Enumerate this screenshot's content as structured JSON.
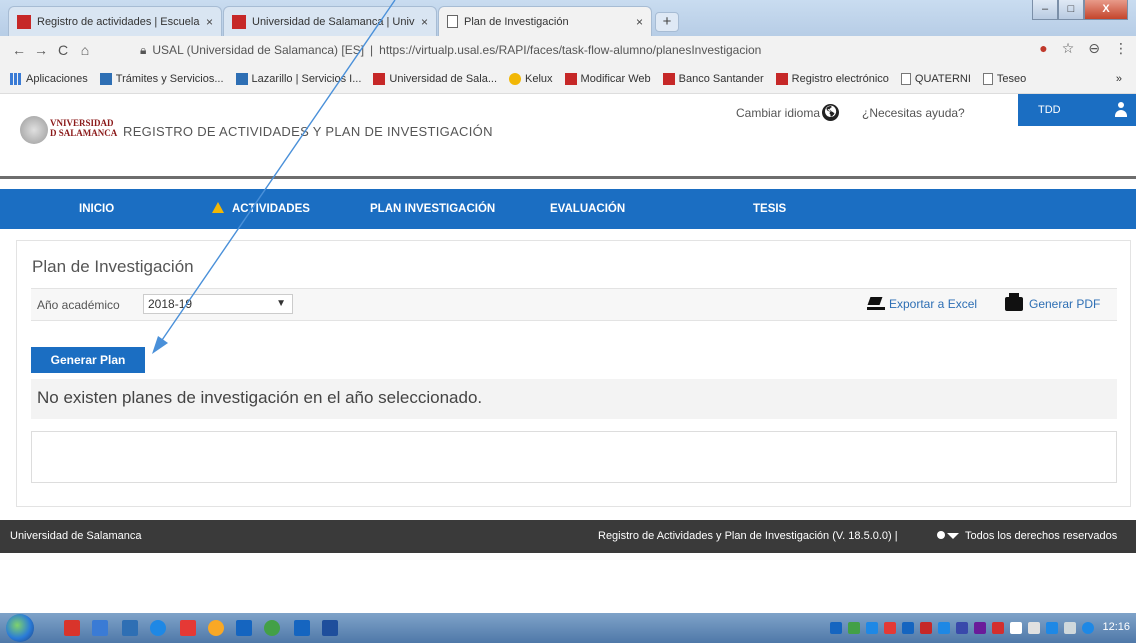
{
  "browser": {
    "tabs": [
      {
        "label": "Registro de actividades | Escuela",
        "close": "×"
      },
      {
        "label": "Universidad de Salamanca | Univ",
        "close": "×"
      },
      {
        "label": "Plan de Investigación",
        "close": "×"
      }
    ],
    "new_tab": "+",
    "window_controls": {
      "minimize": "–",
      "maximize": "□",
      "close": "X"
    },
    "nav": {
      "back": "←",
      "forward": "→",
      "reload": "C",
      "home": "⌂"
    },
    "address": {
      "site": "USAL (Universidad de Salamanca) [ES]",
      "separator": "|",
      "url": "https://virtualp.usal.es/RAPI/faces/task-flow-alumno/planesInvestigacion"
    },
    "toolbar_icons": {
      "extension": "●",
      "star": "☆",
      "profile": "⊖",
      "menu": "⋮"
    },
    "bookmarks": [
      "Aplicaciones",
      "Trámites y Servicios...",
      "Lazarillo | Servicios I...",
      "Universidad de Sala...",
      "Kelux",
      "Modificar Web",
      "Banco Santander",
      "Registro electrónico",
      "QUATERNI",
      "Teseo"
    ],
    "bookmarks_more": "»"
  },
  "header": {
    "logo_line1": "VNIVERSIDAD",
    "logo_line2": "D SALAMANCA",
    "title": "REGISTRO DE ACTIVIDADES Y PLAN DE INVESTIGACIÓN",
    "change_language": "Cambiar idioma",
    "help": "¿Necesitas ayuda?",
    "user": "TDD"
  },
  "nav": {
    "items": [
      "INICIO",
      "ACTIVIDADES",
      "PLAN INVESTIGACIÓN",
      "EVALUACIÓN",
      "TESIS"
    ]
  },
  "main": {
    "page_title": "Plan de Investigación",
    "year_label": "Año académico",
    "year_value": "2018-19",
    "export_excel": "Exportar a Excel",
    "generate_pdf": "Generar PDF",
    "generate_plan": "Generar Plan",
    "empty_message": "No existen planes de investigación en el año seleccionado."
  },
  "footer": {
    "left": "Universidad de Salamanca",
    "app_version": "Registro de Actividades y Plan de Investigación (V. 18.5.0.0) |",
    "rights": "Todos los derechos reservados"
  },
  "taskbar": {
    "clock": "12:16"
  },
  "colors": {
    "brand_blue": "#1b6ec2",
    "footer_dark": "#3a3a3a",
    "warning": "#f2b705",
    "annotation_arrow": "#4a90d9"
  }
}
